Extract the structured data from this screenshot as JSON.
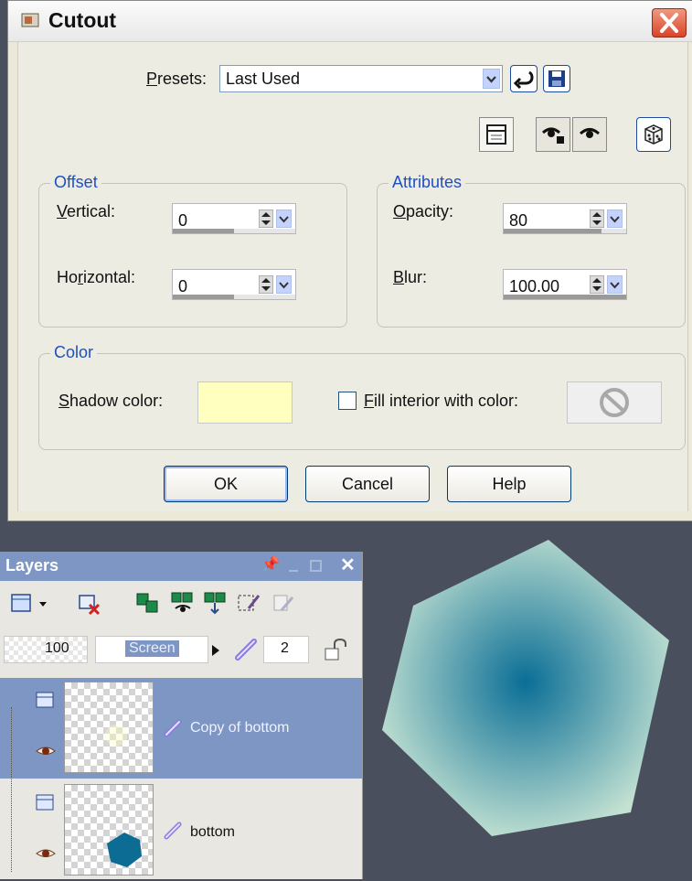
{
  "dialog": {
    "title": "Cutout",
    "presets_label": "Presets:",
    "presets_value": "Last Used",
    "offset": {
      "legend": "Offset",
      "vertical_label": "Vertical:",
      "vertical_value": "0",
      "horizontal_label": "Horizontal:",
      "horizontal_value": "0"
    },
    "attributes": {
      "legend": "Attributes",
      "opacity_label": "Opacity:",
      "opacity_value": "80",
      "blur_label": "Blur:",
      "blur_value": "100.00"
    },
    "color": {
      "legend": "Color",
      "shadow_color_label": "Shadow color:",
      "shadow_color": "#ffffc0",
      "fill_interior_label": "Fill interior with color:",
      "fill_interior_checked": false
    },
    "buttons": {
      "ok": "OK",
      "cancel": "Cancel",
      "help": "Help"
    }
  },
  "layers_palette": {
    "title": "Layers",
    "opacity": "100",
    "blend_mode": "Screen",
    "group_number": "2",
    "layers": [
      {
        "name": "Copy of bottom",
        "selected": true
      },
      {
        "name": "bottom",
        "selected": false
      }
    ]
  },
  "colors": {
    "hexagon_center": "#0a6e96",
    "hexagon_edge": "#c4e2d2",
    "background": "#4a4f5e",
    "palette_title": "#7e96c4"
  }
}
